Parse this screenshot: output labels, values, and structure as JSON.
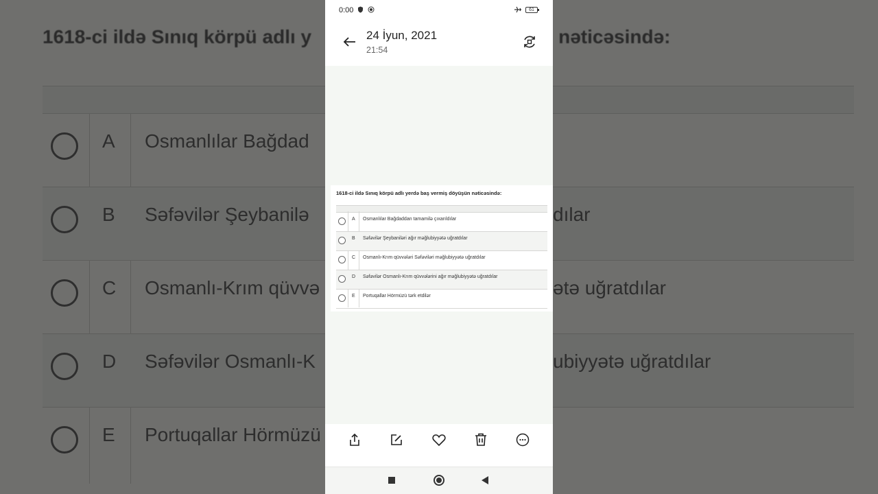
{
  "background": {
    "question": "1618-ci ildə Sınıq körpü adlı y",
    "question_tail": "ün nəticəsində:",
    "rows": [
      {
        "letter": "A",
        "text": "Osmanlılar Bağdad",
        "tail": ""
      },
      {
        "letter": "B",
        "text": "Səfəvilər Şeybanilə",
        "tail": "dılar"
      },
      {
        "letter": "C",
        "text": "Osmanlı-Krım qüvvə",
        "tail": "ətə uğratdılar"
      },
      {
        "letter": "D",
        "text": "Səfəvilər Osmanlı-K",
        "tail": "ubiyyətə uğratdılar"
      },
      {
        "letter": "E",
        "text": "Portuqallar Hörmüzü",
        "tail": ""
      }
    ]
  },
  "status_bar": {
    "time": "0:00",
    "battery": "61",
    "icons": [
      "shield-icon",
      "record-icon",
      "airplane-icon"
    ]
  },
  "header": {
    "title": "24 İyun, 2021",
    "subtitle": "21:54",
    "back_icon": "arrow-left-icon",
    "rotate_icon": "rotate-icon"
  },
  "document": {
    "question": "1618-ci ildə Sınıq körpü adlı yerdə baş vermiş döyüşün nəticəsində:",
    "options": [
      {
        "letter": "A",
        "text": "Osmanlılar Bağdaddan tamamilə çıxarıldılar"
      },
      {
        "letter": "B",
        "text": "Səfəvilər Şeybaniləri ağır məğlubiyyətə uğratdılar"
      },
      {
        "letter": "C",
        "text": "Osmanlı-Krım qüvvələri Səfəviləri məğlubiyyətə uğratdılar"
      },
      {
        "letter": "D",
        "text": "Səfəvilər Osmanlı-Krım qüvvələrini ağır məğlubiyyətə uğratdılar"
      },
      {
        "letter": "E",
        "text": "Portuqallar Hörmüzü tərk etdilər"
      }
    ]
  },
  "toolbar": {
    "icons": [
      "share-icon",
      "edit-icon",
      "heart-icon",
      "trash-icon",
      "more-icon"
    ]
  },
  "navbar": {
    "icons": [
      "recents-icon",
      "home-icon",
      "back-icon"
    ]
  }
}
